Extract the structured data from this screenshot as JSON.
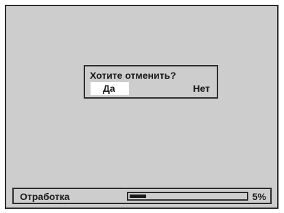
{
  "dialog": {
    "title": "Хотите отменить?",
    "yes_label": "Да",
    "no_label": "Нет",
    "selected_option": "yes"
  },
  "status": {
    "label": "Отработка",
    "progress_fraction": 0.05,
    "percent_text": "5%"
  },
  "colors": {
    "screen_background": "#cdcdcd",
    "border": "#2b2b2b",
    "selection_highlight": "#ffffff",
    "progress_fill": "#1a1a1a"
  }
}
